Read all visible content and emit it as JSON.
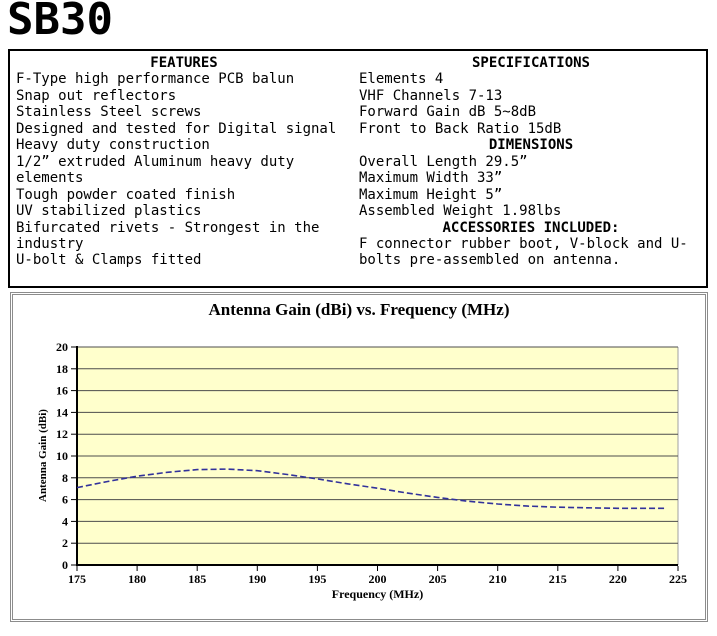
{
  "page": {
    "title": "SB30"
  },
  "info_box": {
    "features": {
      "lines": [
        {
          "t": "FEATURES",
          "h": true
        },
        {
          "t": "F-Type high performance PCB balun",
          "h": false
        },
        {
          "t": "Snap out reflectors",
          "h": false
        },
        {
          "t": "Stainless Steel screws",
          "h": false
        },
        {
          "t": "Designed and tested for Digital signal",
          "h": false
        },
        {
          "t": "Heavy duty construction",
          "h": false
        },
        {
          "t": "1/2” extruded Aluminum heavy duty",
          "h": false
        },
        {
          "t": "elements",
          "h": false
        },
        {
          "t": "Tough powder coated finish",
          "h": false
        },
        {
          "t": "UV stabilized plastics",
          "h": false
        },
        {
          "t": "Bifurcated rivets - Strongest in the",
          "h": false
        },
        {
          "t": "industry",
          "h": false
        },
        {
          "t": "U-bolt & Clamps fitted",
          "h": false
        }
      ]
    },
    "specifications": {
      "lines": [
        {
          "t": "SPECIFICATIONS",
          "h": true
        },
        {
          "t": "Elements 4",
          "h": false
        },
        {
          "t": "VHF Channels 7-13",
          "h": false
        },
        {
          "t": "Forward Gain dB 5~8dB",
          "h": false
        },
        {
          "t": "Front to Back Ratio 15dB",
          "h": false
        },
        {
          "t": "DIMENSIONS",
          "h": true
        },
        {
          "t": "Overall Length 29.5”",
          "h": false
        },
        {
          "t": "Maximum Width 33”",
          "h": false
        },
        {
          "t": "Maximum Height 5”",
          "h": false
        },
        {
          "t": "Assembled Weight 1.98lbs",
          "h": false
        },
        {
          "t": "ACCESSORIES INCLUDED:",
          "h": true
        },
        {
          "t": "F connector rubber boot, V-block and U-",
          "h": false
        },
        {
          "t": "bolts pre-assembled on antenna.",
          "h": false
        }
      ]
    }
  },
  "chart_data": {
    "type": "line",
    "title": "Antenna Gain (dBi) vs. Frequency (MHz)",
    "xlabel": "Frequency (MHz)",
    "ylabel": "Antenna Gain (dBi)",
    "xlim": [
      175,
      225
    ],
    "ylim": [
      0,
      20
    ],
    "xticks": [
      175,
      180,
      185,
      190,
      195,
      200,
      205,
      210,
      215,
      220,
      225
    ],
    "yticks": [
      0,
      2,
      4,
      6,
      8,
      10,
      12,
      14,
      16,
      18,
      20
    ],
    "grid": true,
    "legend": false,
    "plot_bg": "#FFFFCC",
    "grid_color": "#4d4d4d",
    "axis_color": "#000000",
    "line_color": "#32329B",
    "line_style": "dashed",
    "series": [
      {
        "name": "Antenna Gain (dBi)",
        "x": [
          175,
          177.5,
          180,
          182.5,
          185,
          187.5,
          190,
          192.5,
          195,
          197.5,
          200,
          202.5,
          205,
          207.5,
          210,
          212.5,
          215,
          217.5,
          220,
          222.5,
          224
        ],
        "y": [
          7.1,
          7.65,
          8.15,
          8.5,
          8.75,
          8.8,
          8.65,
          8.3,
          7.9,
          7.45,
          7.05,
          6.6,
          6.2,
          5.85,
          5.6,
          5.4,
          5.3,
          5.25,
          5.2,
          5.2,
          5.2
        ]
      }
    ]
  }
}
